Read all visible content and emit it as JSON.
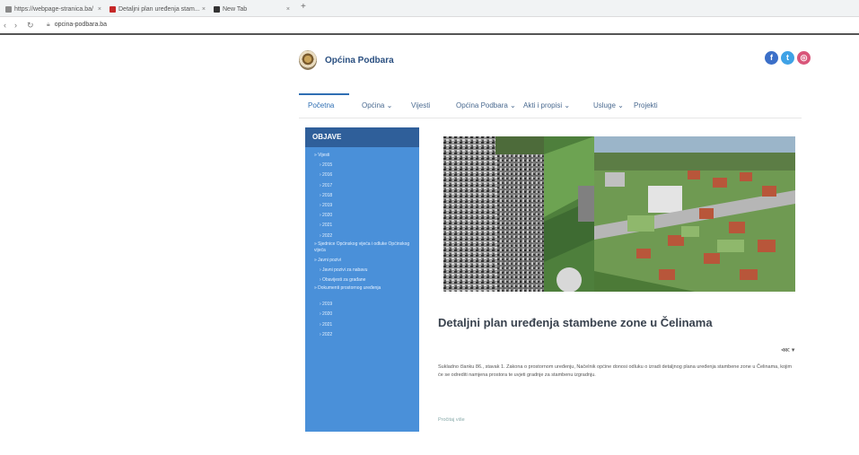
{
  "browser": {
    "tabs": [
      {
        "label": "https://webpage-stranica.ba/"
      },
      {
        "label": "Detaljni plan uređenja stam..."
      },
      {
        "label": "New Tab"
      }
    ],
    "new_tab_label": "+",
    "address": "opcina-podbara.ba"
  },
  "site": {
    "name": "Općina Podbara",
    "social": {
      "facebook": "f",
      "twitter": "t",
      "instagram": "◎"
    }
  },
  "menu": {
    "items": [
      {
        "label": "Početna"
      },
      {
        "label": "Općina ⌄"
      },
      {
        "label": "Vijesti"
      },
      {
        "label": "Općina Podbara ⌄"
      },
      {
        "label": "Akti i propisi ⌄"
      },
      {
        "label": "Usluge ⌄"
      },
      {
        "label": "Projekti"
      }
    ]
  },
  "sidebar": {
    "header": "OBJAVE",
    "items": [
      {
        "label": "» Vijesti"
      },
      {
        "label": "› 2015"
      },
      {
        "label": "› 2016"
      },
      {
        "label": "› 2017"
      },
      {
        "label": "› 2018"
      },
      {
        "label": "› 2019"
      },
      {
        "label": "› 2020"
      },
      {
        "label": "› 2021"
      },
      {
        "label": "› 2022"
      },
      {
        "label": "» Sjednice Općinskog vijeća i odluke Općinskog vijeća"
      },
      {
        "label": "» Javni pozivi"
      },
      {
        "label": "› Javni pozivi za nabavu"
      },
      {
        "label": "› Obavijesti za građane"
      },
      {
        "label": "» Dokumenti prostornog uređenja"
      },
      {
        "label": "› 2019"
      },
      {
        "label": "› 2020"
      },
      {
        "label": "› 2021"
      },
      {
        "label": "› 2022"
      }
    ]
  },
  "article": {
    "title": "Detaljni plan uređenja stambene zone u Čelinama",
    "share": "⋘ ▾",
    "body": "Sukladno članku 86., stavak 1. Zakona o prostornom uređenju, Načelnik općine donosi odluku o izradi detaljnog plana uređenja stambene zone u Čelinama, kojim će se odrediti namjena prostora te uvjeti gradnje za stambenu izgradnju.",
    "more": "Pročitaj više"
  }
}
